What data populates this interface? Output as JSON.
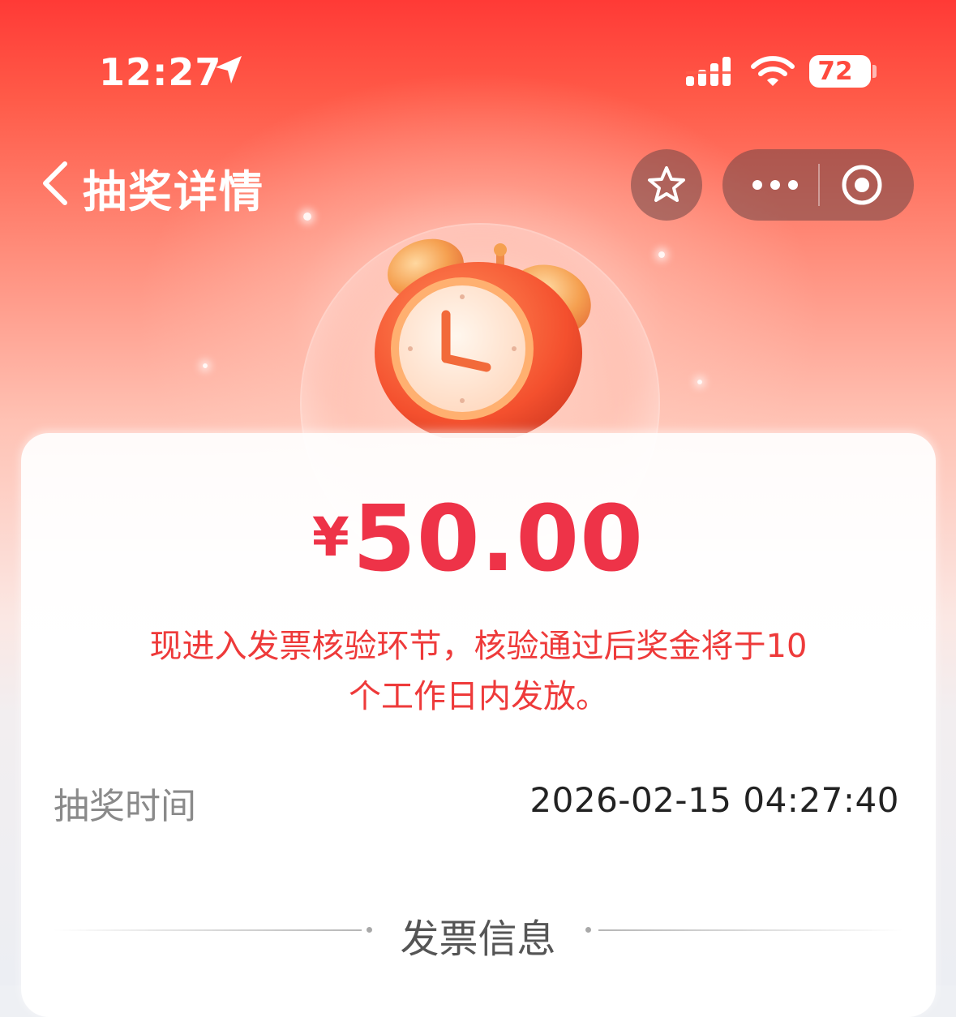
{
  "status_bar": {
    "time": "12:27",
    "battery_level": "72",
    "icons": [
      "location-arrow-icon",
      "signal-icon",
      "wifi-icon",
      "battery-icon"
    ]
  },
  "nav": {
    "title": "抽奖详情",
    "icons": [
      "back-icon",
      "star-icon",
      "more-icon",
      "close-miniprogram-icon"
    ]
  },
  "prize": {
    "currency": "¥",
    "amount": "50.00",
    "notice_line1": "现进入发票核验环节，核验通过后奖金将于10",
    "notice_line2": "个工作日内发放。"
  },
  "details": {
    "draw_time_label": "抽奖时间",
    "draw_time_value": "2026-02-15 04:27:40"
  },
  "section": {
    "invoice_title": "发票信息"
  },
  "colors": {
    "header_red": "#ff3a36",
    "amount_red": "#ee3348",
    "notice_red": "#ee3a3a"
  }
}
